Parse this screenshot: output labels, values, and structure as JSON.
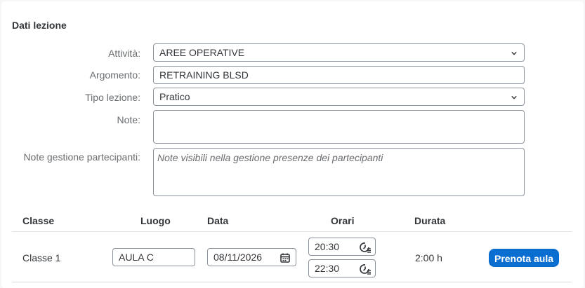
{
  "section_title": "Dati lezione",
  "form": {
    "attivita": {
      "label": "Attività:",
      "value": "AREE OPERATIVE"
    },
    "argomento": {
      "label": "Argomento:",
      "value": "RETRAINING BLSD"
    },
    "tipo_lezione": {
      "label": "Tipo lezione:",
      "value": "Pratico"
    },
    "note": {
      "label": "Note:",
      "value": ""
    },
    "note_gestione": {
      "label": "Note gestione partecipanti:",
      "placeholder": "Note visibili nella gestione presenze dei partecipanti"
    }
  },
  "table": {
    "headers": {
      "classe": "Classe",
      "luogo": "Luogo",
      "data": "Data",
      "orari": "Orari",
      "durata": "Durata"
    },
    "row": {
      "classe": "Classe 1",
      "luogo": "AULA C",
      "data": "08/11/2026",
      "orario_inizio": "20:30",
      "orario_fine": "22:30",
      "durata": "2:00 h",
      "action_label": "Prenota aula"
    }
  },
  "icons": {
    "dropdown": "chevron-down-icon",
    "date": "calendar-icon",
    "time": "clock-icon"
  },
  "colors": {
    "accent": "#0a6ed1",
    "text": "#32363a",
    "label": "#6a6d70",
    "border": "#89919a"
  }
}
